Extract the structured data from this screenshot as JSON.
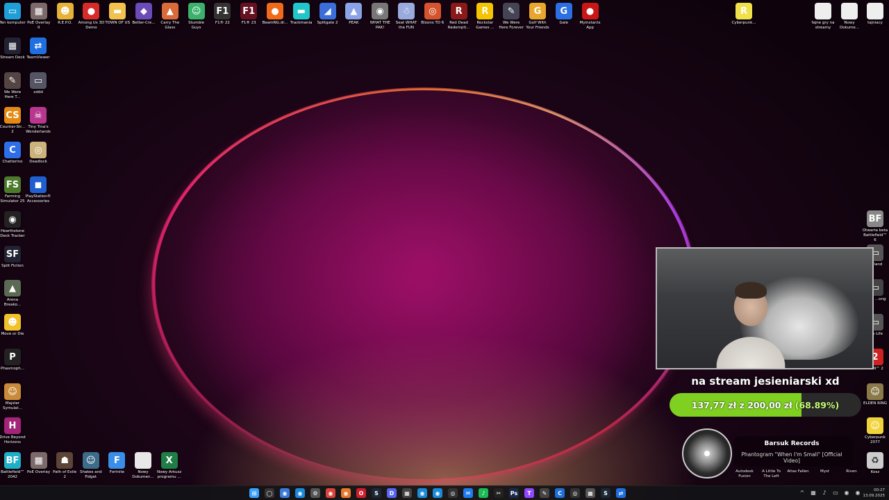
{
  "desktop": {
    "top_row": [
      {
        "label": "Ten komputer",
        "icon": "computer-icon",
        "color": "#1e9fd8",
        "glyph": "▭"
      },
      {
        "label": "PoE Overlay II",
        "icon": "poe-overlay-icon",
        "color": "#7c6a6a",
        "glyph": "▦"
      },
      {
        "label": "R.E.P.O.",
        "icon": "repo-icon",
        "color": "#e7b23a",
        "glyph": "☻"
      },
      {
        "label": "Among Us 3D Demo",
        "icon": "among-us-icon",
        "color": "#d62b2b",
        "glyph": "●"
      },
      {
        "label": "TOWN OF US",
        "icon": "folder-icon",
        "color": "#f2c14e",
        "glyph": "▬"
      },
      {
        "label": "Better-Cre...",
        "icon": "better-crewlink-icon",
        "color": "#6c4bb8",
        "glyph": "◆"
      },
      {
        "label": "Carry The Glass",
        "icon": "carry-the-glass-icon",
        "color": "#d96b3b",
        "glyph": "▲"
      },
      {
        "label": "Stumble Guys",
        "icon": "stumble-guys-icon",
        "color": "#3bb26b",
        "glyph": "☺"
      },
      {
        "label": "F1® 22",
        "icon": "f1-22-icon",
        "color": "#333",
        "glyph": "F1"
      },
      {
        "label": "F1® 23",
        "icon": "f1-23-icon",
        "color": "#612",
        "glyph": "F1"
      },
      {
        "label": "BeamNG.dr...",
        "icon": "beamng-icon",
        "color": "#ef6a1a",
        "glyph": "●"
      },
      {
        "label": "Trackmania",
        "icon": "trackmania-icon",
        "color": "#22c5c9",
        "glyph": "▬"
      },
      {
        "label": "Splitgate 2",
        "icon": "splitgate-icon",
        "color": "#3a6ed8",
        "glyph": "◢"
      },
      {
        "label": "PEAK",
        "icon": "peak-icon",
        "color": "#8aa3e6",
        "glyph": "▲"
      },
      {
        "label": "WHAT THE PAK!",
        "icon": "what-the-pak-icon",
        "color": "#777",
        "glyph": "◉"
      },
      {
        "label": "Seat WHAT the FUN",
        "icon": "seat-what-the-fun-icon",
        "color": "#9ad",
        "glyph": "☃"
      },
      {
        "label": "Bloons TD 6",
        "icon": "bloons-icon",
        "color": "#d5542e",
        "glyph": "◎"
      },
      {
        "label": "Red Dead Redempti...",
        "icon": "red-dead-icon",
        "color": "#8a1a1a",
        "glyph": "R"
      },
      {
        "label": "Rockstar Games ...",
        "icon": "rockstar-icon",
        "color": "#f4c400",
        "glyph": "R"
      },
      {
        "label": "We Were Here Forever",
        "icon": "we-were-here-icon",
        "color": "#445",
        "glyph": "✎"
      },
      {
        "label": "Golf With Your Friends",
        "icon": "golf-icon",
        "color": "#e8a62c",
        "glyph": "G"
      },
      {
        "label": "Gale",
        "icon": "gale-icon",
        "color": "#2b6fe0",
        "glyph": "G"
      },
      {
        "label": "Myinstants App",
        "icon": "myinstants-icon",
        "color": "#c91717",
        "glyph": "●"
      }
    ],
    "left_col": [
      {
        "label": "Stream Deck",
        "icon": "stream-deck-icon",
        "color": "#223",
        "glyph": "▦"
      },
      {
        "label": "TeamViewer",
        "icon": "teamviewer-icon",
        "color": "#1f6fe0",
        "glyph": "⇄"
      },
      {
        "label": "We Were Here T...",
        "icon": "we-were-here-together-icon",
        "color": "#544",
        "glyph": "✎"
      },
      {
        "label": "xddd",
        "icon": "xddd-icon",
        "color": "#556",
        "glyph": "▭"
      },
      {
        "label": "Counter-Str... 2",
        "icon": "cs2-icon",
        "color": "#e48a14",
        "glyph": "CS"
      },
      {
        "label": "Tiny Tina's Wonderlands",
        "icon": "tiny-tina-icon",
        "color": "#b8368f",
        "glyph": "☠"
      },
      {
        "label": "Chatterino",
        "icon": "chatterino-icon",
        "color": "#2e6fe8",
        "glyph": "C"
      },
      {
        "label": "Deadlock",
        "icon": "deadlock-icon",
        "color": "#cbb37b",
        "glyph": "◎"
      },
      {
        "label": "Farming Simulator 25",
        "icon": "farming-icon",
        "color": "#4c7a2b",
        "glyph": "FS"
      },
      {
        "label": "PlayStation® Accessories",
        "icon": "playstation-icon",
        "color": "#1f5fcf",
        "glyph": "◼"
      },
      {
        "label": "Hearthstone Deck Tracker",
        "icon": "hearthstone-icon",
        "color": "#222",
        "glyph": "◉"
      },
      {
        "label": "Split Fiction",
        "icon": "split-fiction-icon",
        "color": "#223",
        "glyph": "SF"
      },
      {
        "label": "Arena Breako...",
        "icon": "arena-breakout-icon",
        "color": "#5a6a55",
        "glyph": "▲"
      },
      {
        "label": "Move or Die",
        "icon": "move-or-die-icon",
        "color": "#f2c22c",
        "glyph": "☻"
      },
      {
        "label": "Phasmoph...",
        "icon": "phasmophobia-icon",
        "color": "#222",
        "glyph": "P"
      },
      {
        "label": "Majster Symulat...",
        "icon": "majster-icon",
        "color": "#c98a3a",
        "glyph": "☺"
      },
      {
        "label": "Drive Beyond Horizons",
        "icon": "drive-beyond-icon",
        "color": "#a3247a",
        "glyph": "H"
      }
    ],
    "bottom_row": [
      {
        "label": "Battlefield™ 2042",
        "icon": "battlefield-2042-icon",
        "color": "#1fb0c9",
        "glyph": "BF"
      },
      {
        "label": "PoE Overlay",
        "icon": "poe-overlay-2-icon",
        "color": "#7c6a6a",
        "glyph": "▦"
      },
      {
        "label": "Path of Exile 2",
        "icon": "path-of-exile-icon",
        "color": "#5c4536",
        "glyph": "☗"
      },
      {
        "label": "Shakes and Fidget",
        "icon": "shakes-fidget-icon",
        "color": "#3d6b8a",
        "glyph": "☺"
      },
      {
        "label": "Fortnite",
        "icon": "fortnite-icon",
        "color": "#3a8ee8",
        "glyph": "F"
      },
      {
        "label": "Nowy Dokumen...",
        "icon": "document-icon",
        "color": "#e8e8e8",
        "glyph": ""
      },
      {
        "label": "Nowy Arkusz programu ...",
        "icon": "excel-icon",
        "color": "#1e7e45",
        "glyph": "X"
      }
    ],
    "top_right": [
      {
        "label": "Cyberpunk...",
        "icon": "cyberpunk-launcher-icon",
        "color": "#f0e04a",
        "glyph": "R"
      },
      {
        "label": "fajne gry na streamy",
        "icon": "text-file-icon",
        "color": "#eee",
        "glyph": ""
      },
      {
        "label": "Nowy Dokume...",
        "icon": "text-file-2-icon",
        "color": "#eee",
        "glyph": ""
      },
      {
        "label": "tajniacy",
        "icon": "text-file-3-icon",
        "color": "#eee",
        "glyph": ""
      }
    ],
    "right_col": [
      {
        "label": "Otwarta beta Battlefield™ 6",
        "icon": "battlefield-6-icon",
        "color": "#888",
        "glyph": "BF"
      },
      {
        "label": "...nland",
        "icon": "partial-icon-1",
        "color": "#555",
        "glyph": "▭"
      },
      {
        "label": "Myth ...ong",
        "icon": "partial-icon-2",
        "color": "#444",
        "glyph": "▭"
      },
      {
        "label": "...In Life",
        "icon": "partial-icon-3",
        "color": "#555",
        "glyph": "▭"
      },
      {
        "label": "...AN™ 2",
        "icon": "partial-icon-4",
        "color": "#c22",
        "glyph": "2"
      },
      {
        "label": "ELDEN RING",
        "icon": "elden-ring-icon",
        "color": "#8a7a4a",
        "glyph": "☺"
      },
      {
        "label": "Cyberpunk 2077",
        "icon": "cyberpunk-icon",
        "color": "#f0d33a",
        "glyph": "☺"
      },
      {
        "label": "Kosz",
        "icon": "recycle-bin-icon",
        "color": "#ccc",
        "glyph": "♻"
      }
    ]
  },
  "stream": {
    "goal_title": "na stream jesieniarski xd",
    "goal_amount": "137,77 zł z 200,00 zł",
    "goal_percent_text": "(68.89%)",
    "goal_fraction": 0.6889,
    "accent": "#7fd021"
  },
  "music": {
    "artist": "Barsuk Records",
    "title": "Phantogram \"When I'm Small\" [Official Video]"
  },
  "music_bottom": {
    "items": [
      "Autodesk Fusion",
      "A Little To The Left",
      "Atlas Fallen",
      "Myst",
      "Riven"
    ]
  },
  "taskbar": {
    "icons": [
      {
        "name": "start-icon",
        "color": "#3aa0ff",
        "glyph": "⊞"
      },
      {
        "name": "search-icon",
        "color": "#333",
        "glyph": "◯"
      },
      {
        "name": "chrome-icon",
        "color": "#3b7bd8",
        "glyph": "◉"
      },
      {
        "name": "edge-icon",
        "color": "#1b8ad8",
        "glyph": "◉"
      },
      {
        "name": "settings-icon",
        "color": "#555",
        "glyph": "⚙"
      },
      {
        "name": "chrome-2-icon",
        "color": "#d8433a",
        "glyph": "◉"
      },
      {
        "name": "firefox-icon",
        "color": "#e8782a",
        "glyph": "◉"
      },
      {
        "name": "opera-icon",
        "color": "#d21c2b",
        "glyph": "O"
      },
      {
        "name": "steam-icon",
        "color": "#1b2838",
        "glyph": "S"
      },
      {
        "name": "discord-icon",
        "color": "#5865f2",
        "glyph": "D"
      },
      {
        "name": "taskbar-app-icon",
        "color": "#444",
        "glyph": "▦"
      },
      {
        "name": "edge-2-icon",
        "color": "#1b8ad8",
        "glyph": "◉"
      },
      {
        "name": "edge-3-icon",
        "color": "#1b8ad8",
        "glyph": "◉"
      },
      {
        "name": "obs-icon",
        "color": "#333",
        "glyph": "◎"
      },
      {
        "name": "messenger-icon",
        "color": "#1e7cf0",
        "glyph": "✉"
      },
      {
        "name": "spotify-icon",
        "color": "#1db954",
        "glyph": "♪"
      },
      {
        "name": "capcut-icon",
        "color": "#222",
        "glyph": "✂"
      },
      {
        "name": "photoshop-icon",
        "color": "#1a2a4a",
        "glyph": "Ps"
      },
      {
        "name": "twitch-icon",
        "color": "#9146ff",
        "glyph": "T"
      },
      {
        "name": "pen-icon",
        "color": "#444",
        "glyph": "✎"
      },
      {
        "name": "c-app-icon",
        "color": "#1e6fd8",
        "glyph": "C"
      },
      {
        "name": "obs-2-icon",
        "color": "#333",
        "glyph": "◎"
      },
      {
        "name": "taskbar-grid-icon",
        "color": "#555",
        "glyph": "▦"
      },
      {
        "name": "steam-2-icon",
        "color": "#1b2838",
        "glyph": "S"
      },
      {
        "name": "teamviewer-taskbar-icon",
        "color": "#1f6fe0",
        "glyph": "⇄"
      }
    ],
    "time": "00:27",
    "date": "13.09.2025"
  }
}
